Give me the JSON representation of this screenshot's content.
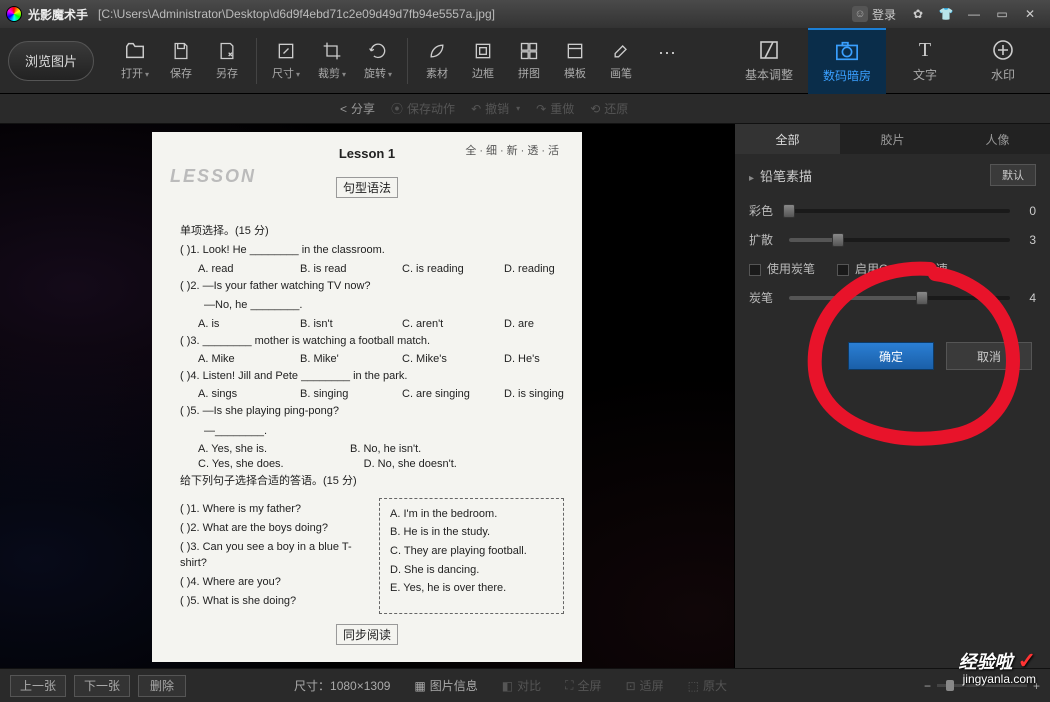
{
  "title": "光影魔术手",
  "filepath": "[C:\\Users\\Administrator\\Desktop\\d6d9f4ebd71c2e09d49d7fb94e5557a.jpg]",
  "login": "登录",
  "browse": "浏览图片",
  "toolbar": {
    "open": "打开",
    "save": "保存",
    "saveas": "另存",
    "size": "尺寸",
    "crop": "裁剪",
    "rotate": "旋转",
    "material": "素材",
    "border": "边框",
    "collage": "拼图",
    "template": "模板",
    "brush": "画笔",
    "more": "..."
  },
  "righttools": {
    "basic": "基本调整",
    "darkroom": "数码暗房",
    "text": "文字",
    "watermark": "水印"
  },
  "subbar": {
    "share": "分享",
    "saveaction": "保存动作",
    "undo": "撤销",
    "redo": "重做",
    "restore": "还原"
  },
  "panel": {
    "tabs": {
      "all": "全部",
      "film": "胶片",
      "portrait": "人像"
    },
    "effect": "铅笔素描",
    "default": "默认",
    "color": "彩色",
    "color_val": "0",
    "diffuse": "扩散",
    "diffuse_val": "3",
    "charcoal_chk": "使用炭笔",
    "opencl_chk": "启用OpenCL加速",
    "charcoal": "炭笔",
    "charcoal_val": "4",
    "ok": "确定",
    "cancel": "取消"
  },
  "bottom": {
    "prev": "上一张",
    "next": "下一张",
    "delete": "删除",
    "dim_label": "尺寸：",
    "dim": "1080×1309",
    "imginfo": "图片信息",
    "compare": "对比",
    "fullscreen": "全屏",
    "fit": "适屏",
    "orig": "原大"
  },
  "doc": {
    "lesson": "Lesson 1",
    "corner": "全·细·新·透·活",
    "faded": "LESSON",
    "sec1": "句型语法",
    "sec2": "同步阅读",
    "part1_title": "单项选择。(15 分)",
    "q1": " )1. Look!  He ________ in the classroom.",
    "q1a": "A. read",
    "q1b": "B. is read",
    "q1c": "C. is reading",
    "q1d": "D. reading",
    "q2": " )2. —Is your father watching TV now?",
    "q2n": "—No, he ________.",
    "q2a": "A. is",
    "q2b": "B. isn't",
    "q2c": "C. aren't",
    "q2d": "D. are",
    "q3": " )3. ________ mother is watching a football match.",
    "q3a": "A. Mike",
    "q3b": "B. Mike'",
    "q3c": "C. Mike's",
    "q3d": "D. He's",
    "q4": " )4. Listen!  Jill and Pete ________ in the park.",
    "q4a": "A. sings",
    "q4b": "B. singing",
    "q4c": "C. are singing",
    "q4d": "D. is singing",
    "q5": " )5. —Is she playing ping-pong?",
    "q5n": "—________.",
    "q5a": "A. Yes, she is.",
    "q5b": "B. No, he isn't.",
    "q5c": "C. Yes, she does.",
    "q5d": "D. No, she doesn't.",
    "part2_title": "给下列句子选择合适的答语。(15 分)",
    "p2q1": "(    )1. Where is my father?",
    "p2q2": "(    )2. What are the boys doing?",
    "p2q3": "(    )3. Can you see a boy in a blue T-shirt?",
    "p2q4": "(    )4. Where are you?",
    "p2q5": "(    )5. What is she doing?",
    "aA": "A. I'm in the bedroom.",
    "aB": "B. He is in the study.",
    "aC": "C. They are playing football.",
    "aD": "D. She is dancing.",
    "aE": "E. Yes, he is over there."
  },
  "watermark": {
    "main": "经验啦",
    "sub": "jingyanla.com"
  }
}
